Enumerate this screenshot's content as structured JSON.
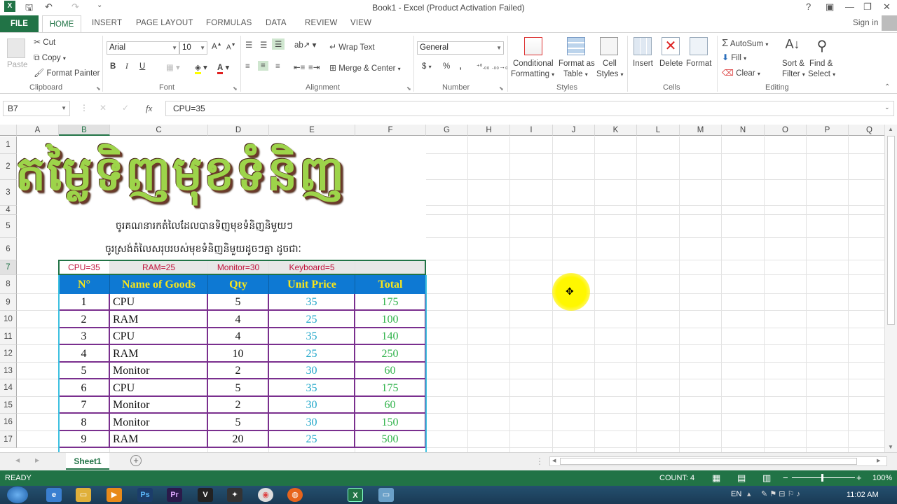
{
  "window": {
    "title": "Book1 - Excel (Product Activation Failed)",
    "sign_in": "Sign in",
    "help": "?",
    "minimize": "—",
    "restore": "❐",
    "close": "✕"
  },
  "tabs": [
    "FILE",
    "HOME",
    "INSERT",
    "PAGE LAYOUT",
    "FORMULAS",
    "DATA",
    "REVIEW",
    "VIEW"
  ],
  "ribbon": {
    "clipboard": {
      "paste": "Paste",
      "cut": "Cut",
      "copy": "Copy",
      "format_painter": "Format Painter",
      "label": "Clipboard"
    },
    "font": {
      "name": "Arial",
      "size": "10",
      "bold": "B",
      "italic": "I",
      "underline": "U",
      "label": "Font"
    },
    "alignment": {
      "wrap_text": "Wrap Text",
      "merge_center": "Merge & Center",
      "label": "Alignment"
    },
    "number": {
      "format": "General",
      "currency": "$",
      "percent": "%",
      "comma": ",",
      "label": "Number"
    },
    "styles": {
      "conditional": "Conditional",
      "conditional2": "Formatting",
      "format_as": "Format as",
      "format_as2": "Table",
      "cell": "Cell",
      "cell2": "Styles",
      "label": "Styles"
    },
    "cells": {
      "insert": "Insert",
      "delete": "Delete",
      "format": "Format",
      "label": "Cells"
    },
    "editing": {
      "autosum": "AutoSum",
      "fill": "Fill",
      "clear": "Clear",
      "sort": "Sort &",
      "sort2": "Filter",
      "find": "Find &",
      "find2": "Select",
      "label": "Editing"
    }
  },
  "formula_bar": {
    "name_box": "B7",
    "fx": "fx",
    "content": "CPU=35"
  },
  "columns": [
    "A",
    "B",
    "C",
    "D",
    "E",
    "F",
    "G",
    "H",
    "I",
    "J",
    "K",
    "L",
    "M",
    "N",
    "O",
    "P",
    "Q"
  ],
  "rows": [
    "1",
    "2",
    "3",
    "4",
    "5",
    "6",
    "7",
    "8",
    "9",
    "10",
    "11",
    "12",
    "13",
    "14",
    "15",
    "16",
    "17"
  ],
  "sheet": {
    "big_title": "តម្លៃទិញមុខទំនិញ",
    "line5": "ចូរគណនារកតំលៃដែលបានទិញមុខទំនិញនិមួយៗ",
    "line6": "ចូរស្រង់តំលៃសរុបរបស់មុខទំនិញនិមួយដូចៗគ្នា ដូចជាៈ",
    "row7": [
      "CPU=35",
      "RAM=25",
      "Monitor=30",
      "Keyboard=5",
      ""
    ],
    "headers": [
      "N°",
      "Name of Goods",
      "Qty",
      "Unit Price",
      "Total"
    ],
    "data": [
      [
        "1",
        "CPU",
        "5",
        "35",
        "175"
      ],
      [
        "2",
        "RAM",
        "4",
        "25",
        "100"
      ],
      [
        "3",
        "CPU",
        "4",
        "35",
        "140"
      ],
      [
        "4",
        "RAM",
        "10",
        "25",
        "250"
      ],
      [
        "5",
        "Monitor",
        "2",
        "30",
        "60"
      ],
      [
        "6",
        "CPU",
        "5",
        "35",
        "175"
      ],
      [
        "7",
        "Monitor",
        "2",
        "30",
        "60"
      ],
      [
        "8",
        "Monitor",
        "5",
        "30",
        "150"
      ],
      [
        "9",
        "RAM",
        "20",
        "25",
        "500"
      ]
    ]
  },
  "sheet_tabs": {
    "active": "Sheet1",
    "add": "+"
  },
  "status": {
    "ready": "READY",
    "count": "COUNT: 4",
    "zoom": "100%"
  },
  "taskbar": {
    "lang": "EN",
    "time": "11:02 AM"
  },
  "colors": {
    "excel_green": "#217346",
    "header_blue": "#0e79d3",
    "header_text": "#f7e51b",
    "red_text": "#c0143c",
    "teal_text": "#1fa6c9",
    "green_text": "#2fb24a"
  }
}
